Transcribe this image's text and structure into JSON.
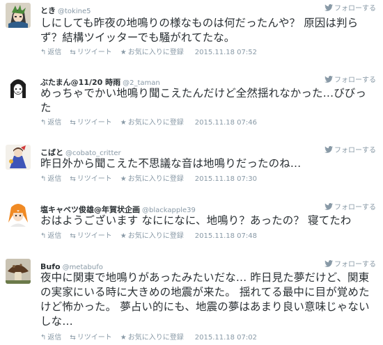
{
  "tweets": [
    {
      "name": "とき",
      "handle": "@tokine5",
      "text": "しにしても昨夜の地鳴りの様なものは何だったんや？ 原因は判らず？結構ツイッターでも騒がれてたな。",
      "timestamp": "2015.11.18 07:52",
      "avatar": "avatar-anime-character-icon"
    },
    {
      "name": "ぶたまん@11/20 時雨",
      "handle": "@2_taman",
      "text": "めっちゃでかい地鳴り聞こえたんだけど全然揺れなかった…びびった",
      "timestamp": "2015.11.18 07:46",
      "avatar": "avatar-girl-drawing-icon"
    },
    {
      "name": "こばと",
      "handle": "@cobato_critter",
      "text": "昨日外から聞こえた不思議な音は地鳴りだったのね…",
      "timestamp": "2015.11.18 07:30",
      "avatar": "avatar-figure-toy-icon"
    },
    {
      "name": "塩キャベツ俊雄@年賀状企画",
      "handle": "@blackapple39",
      "text": "おはようございます なにになに、地鳴り？あったの？ 寝てたわ",
      "timestamp": "2015.11.18 07:48",
      "avatar": "avatar-orange-hair-character-icon"
    },
    {
      "name": "Bufo",
      "handle": "@metabufo",
      "text": "夜中に関東で地鳴りがあったみたいだな… 昨日見た夢だけど、関東の実家にいる時に大きめの地震が来た。 揺れてる最中に目が覚めたけど怖かった。 夢占い的にも、地震の夢はあまり良い意味じゃないしな…",
      "timestamp": "2015.11.18 07:02",
      "avatar": "avatar-mushroom-icon"
    }
  ],
  "labels": {
    "follow": "フォローする",
    "reply": "返信",
    "retweet": "リツイート",
    "favorite": "お気に入りに登録"
  },
  "icons": {
    "reply": "reply-arrow-icon",
    "retweet": "retweet-icon",
    "favorite": "star-icon",
    "follow": "twitter-bird-icon"
  },
  "colors": {
    "text": "#292f33",
    "meta": "#8899a6"
  }
}
